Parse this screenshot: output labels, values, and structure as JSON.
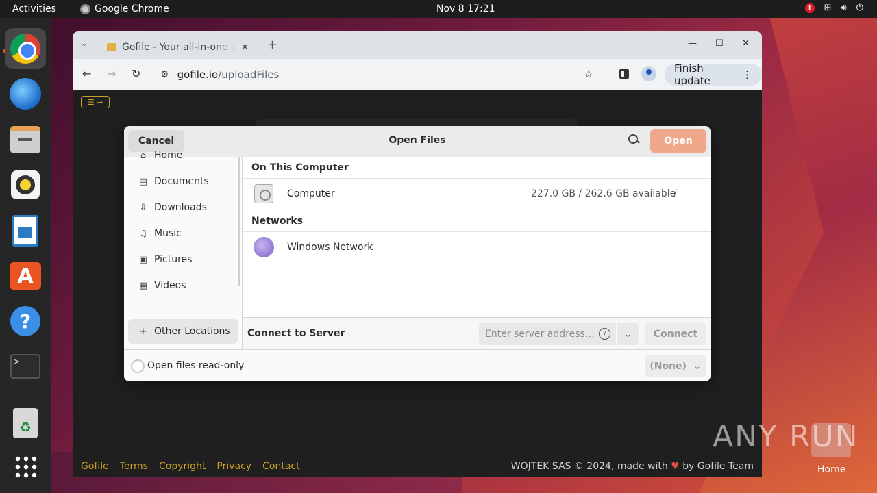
{
  "topbar": {
    "activities": "Activities",
    "app_name": "Google Chrome",
    "clock": "Nov 8  17:21"
  },
  "dock": {
    "items": [
      "google-chrome",
      "thunderbird",
      "files",
      "rhythmbox",
      "libreoffice-writer",
      "app-center",
      "help",
      "terminal",
      "trash",
      "show-apps"
    ]
  },
  "browser": {
    "tab_title": "Gofile - Your all-in-one storage solution",
    "url_host": "gofile.io",
    "url_path": "/uploadFiles",
    "finish_update": "Finish update",
    "footer_links": [
      "Gofile",
      "Terms",
      "Copyright",
      "Privacy",
      "Contact"
    ],
    "footer_right_prefix": "WOJTEK SAS © 2024, made with",
    "footer_right_suffix": "by Gofile Team"
  },
  "dialog": {
    "title": "Open Files",
    "cancel": "Cancel",
    "open": "Open",
    "sidebar": [
      "Home",
      "Documents",
      "Downloads",
      "Music",
      "Pictures",
      "Videos"
    ],
    "other_locations": "Other Locations",
    "section_computer": "On This Computer",
    "computer_name": "Computer",
    "computer_space": "227.0 GB / 262.6 GB available",
    "computer_mount": "/",
    "section_networks": "Networks",
    "network_name": "Windows Network",
    "connect_label": "Connect to Server",
    "server_placeholder": "Enter server address…",
    "connect": "Connect",
    "read_only": "Open files read-only",
    "filter": "(None)"
  },
  "desktop": {
    "watermark": "ANY RUN",
    "home_label": "Home"
  },
  "colors": {
    "accent_orange": "#e95420",
    "open_button": "#f0a88a",
    "footer_link": "#c9a227"
  }
}
